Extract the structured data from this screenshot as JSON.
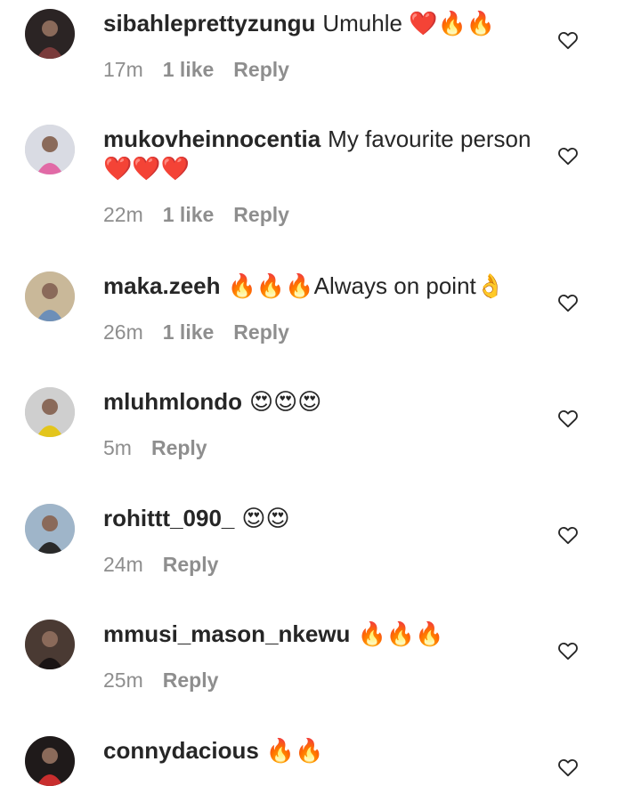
{
  "comments": [
    {
      "username": "sibahleprettyzungu",
      "text": "Umuhle ❤️🔥🔥",
      "time": "17m",
      "likes": "1 like",
      "reply": "Reply",
      "avatar": "avatar-person-glasses-icon",
      "avatar_colors": [
        "#2b2424",
        "#7a3b3b"
      ]
    },
    {
      "username": "mukovheinnocentia",
      "text": "My favourite person ❤️❤️❤️",
      "time": "22m",
      "likes": "1 like",
      "reply": "Reply",
      "avatar": "avatar-person-pink-icon",
      "avatar_colors": [
        "#d9dbe3",
        "#e16aa6"
      ]
    },
    {
      "username": "maka.zeeh",
      "text": "🔥🔥🔥Always on point👌",
      "time": "26m",
      "likes": "1 like",
      "reply": "Reply",
      "avatar": "avatar-person-outdoor-icon",
      "avatar_colors": [
        "#c9b899",
        "#6d8fb8"
      ]
    },
    {
      "username": "mluhmlondo",
      "text": "😍😍😍",
      "time": "5m",
      "likes": "",
      "reply": "Reply",
      "avatar": "avatar-person-yellow-icon",
      "avatar_colors": [
        "#cfcfcf",
        "#e3c51c"
      ]
    },
    {
      "username": "rohittt_090_",
      "text": "😍😍",
      "time": "24m",
      "likes": "",
      "reply": "Reply",
      "avatar": "avatar-person-sky-icon",
      "avatar_colors": [
        "#9fb5c9",
        "#2a2a2a"
      ]
    },
    {
      "username": "mmusi_mason_nkewu",
      "text": "🔥🔥🔥",
      "time": "25m",
      "likes": "",
      "reply": "Reply",
      "avatar": "avatar-person-face-icon",
      "avatar_colors": [
        "#4a3a33",
        "#1a1414"
      ]
    },
    {
      "username": "connydacious",
      "text": "🔥🔥",
      "time": "",
      "likes": "",
      "reply": "",
      "avatar": "avatar-person-red-icon",
      "avatar_colors": [
        "#1f1a1a",
        "#c92e2e"
      ]
    }
  ],
  "icons": {
    "like": "heart-outline-icon"
  }
}
